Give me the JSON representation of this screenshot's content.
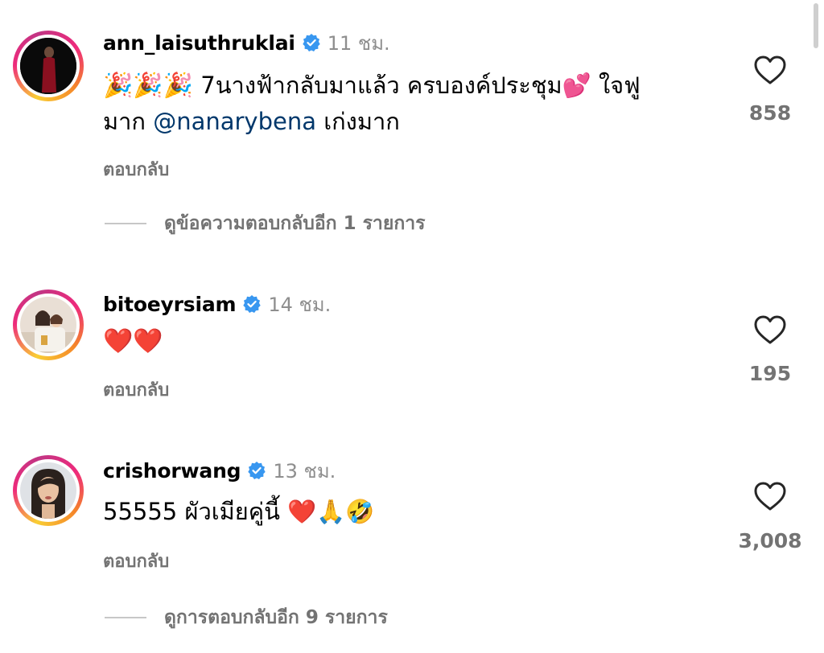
{
  "comments": [
    {
      "username": "ann_laisuthruklai",
      "time": "11 ชม.",
      "text_emoji": "🎉🎉🎉",
      "text_line1": " 7นางฟ้ากลับมาแล้ว ครบองค์ประชุม💕 ใจฟู",
      "text_line2_before": "มาก ",
      "mention": "@nanarybena",
      "text_line2_after": " เก่งมาก",
      "reply_label": "ตอบกลับ",
      "likes": "858",
      "more_replies": "ดูข้อความตอบกลับอีก 1 รายการ"
    },
    {
      "username": "bitoeyrsiam",
      "time": "14 ชม.",
      "text": "❤️❤️",
      "reply_label": "ตอบกลับ",
      "likes": "195"
    },
    {
      "username": "crishorwang",
      "time": "13 ชม.",
      "text": "55555 ผัวเมียคู่นี้ ❤️🙏🤣",
      "reply_label": "ตอบกลับ",
      "likes": "3,008",
      "more_replies": "ดูการตอบกลับอีก 9 รายการ"
    }
  ],
  "colors": {
    "verified": "#3897f0",
    "muted": "#737373",
    "mention": "#00376b"
  },
  "icons": [
    "verified-badge-icon",
    "heart-outline-icon"
  ]
}
